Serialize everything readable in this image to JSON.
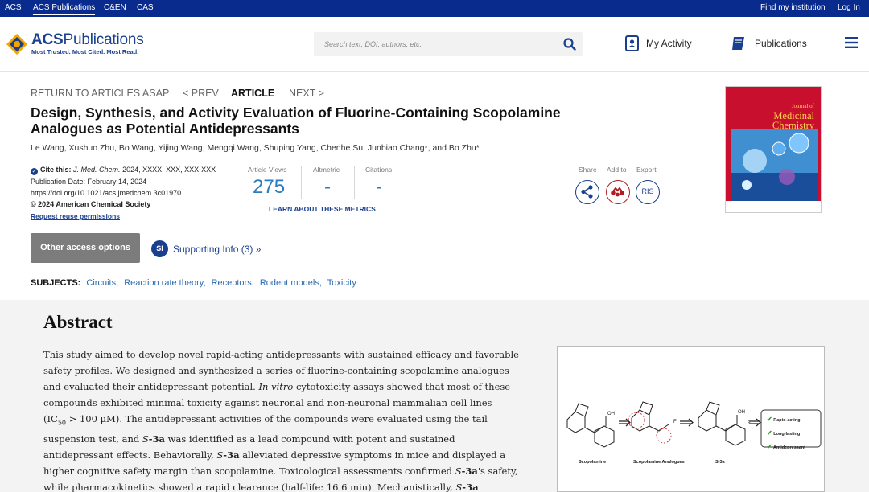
{
  "topbar": {
    "left_links": [
      "ACS",
      "ACS Publications",
      "C&EN",
      "CAS"
    ],
    "find_institution": "Find my institution",
    "login": "Log In"
  },
  "header": {
    "logo_name_bold": "ACS",
    "logo_name_rest": "Publications",
    "logo_tagline": "Most Trusted. Most Cited. Most Read.",
    "search_placeholder": "Search text, DOI, authors, etc.",
    "my_activity": "My Activity",
    "publications": "Publications"
  },
  "article_nav": {
    "return": "RETURN TO ARTICLES ASAP",
    "prev": "< PREV",
    "article": "ARTICLE",
    "next": "NEXT >"
  },
  "article": {
    "title_line1": "Design, Synthesis, and Activity Evaluation of Fluorine-Containing Scopolamine",
    "title_line2": "Analogues as Potential Antidepressants",
    "authors": "Le Wang, Xushuo Zhu, Bo Wang, Yijing Wang, Mengqi Wang, Shuping Yang, Chenhe Su, Junbiao Chang*, and Bo Zhu*",
    "cite_label": "Cite this:",
    "cite_journal": "J. Med. Chem.",
    "cite_rest": "2024, XXXX, XXX, XXX-XXX",
    "pub_date": "Publication Date: February 14, 2024",
    "doi": "https://doi.org/10.1021/acs.jmedchem.3c01970",
    "copyright": "© 2024 American Chemical Society",
    "reuse": "Request reuse permissions"
  },
  "metrics": {
    "views_label": "Article Views",
    "views_value": "275",
    "altmetric_label": "Altmetric",
    "altmetric_value": "-",
    "citations_label": "Citations",
    "citations_value": "-",
    "learn_link": "LEARN ABOUT THESE METRICS"
  },
  "tools": {
    "share": "Share",
    "add_to": "Add to",
    "export": "Export",
    "ris": "RIS"
  },
  "cover": {
    "line1": "Journal of",
    "line2": "Medicinal",
    "line3": "Chemistry"
  },
  "access": {
    "other_options": "Other access options",
    "si_badge": "SI",
    "supporting_info": "Supporting Info (3) »"
  },
  "subjects": {
    "label": "SUBJECTS:",
    "items": [
      "Circuits",
      "Reaction rate theory",
      "Receptors",
      "Rodent models",
      "Toxicity"
    ]
  },
  "abstract": {
    "heading": "Abstract",
    "l1": "This study aimed to develop novel rapid-acting antidepressants with sustained efficacy and favorable",
    "l2": "safety profiles. We designed and synthesized a series of fluorine-containing scopolamine analogues",
    "l3": "and evaluated their antidepressant potential.",
    "l3_italic": "In vitro",
    "l3_end": "cytotoxicity assays showed that most of these",
    "l4": "compounds exhibited minimal toxicity against neuronal and non-neuronal mammalian cell lines",
    "l5_a": "(IC",
    "l5_sub": "50",
    "l5_b": "> 100 μM). The antidepressant activities of the compounds were evaluated using the tail",
    "l6_a": "suspension test, and",
    "l6_s": "S",
    "l6_bold": "-3a",
    "l6_b": "was identified as a lead compound with potent and sustained",
    "l7_a": "antidepressant effects. Behaviorally,",
    "l7_b": "alleviated depressive symptoms in mice and displayed a",
    "l8_a": "higher cognitive safety margin than scopolamine. Toxicological assessments confirmed",
    "l8_b": "'s safety,",
    "l9_a": "while pharmacokinetics showed a rapid clearance (half-life: 16.6 min). Mechanistically,"
  },
  "toc_graphic": {
    "cap1": "Scopolamine",
    "cap2": "Scopolamine Analogues",
    "cap3": "S-3a",
    "check1": "Rapid-acting",
    "check2": "Long-lasting",
    "check3": "Antidepressant"
  },
  "colors": {
    "topbar": "#0a2b8e",
    "brand": "#1a3f8f",
    "metric": "#2a7bc0",
    "link": "#2a6ab0",
    "cover": "#c8102e"
  }
}
